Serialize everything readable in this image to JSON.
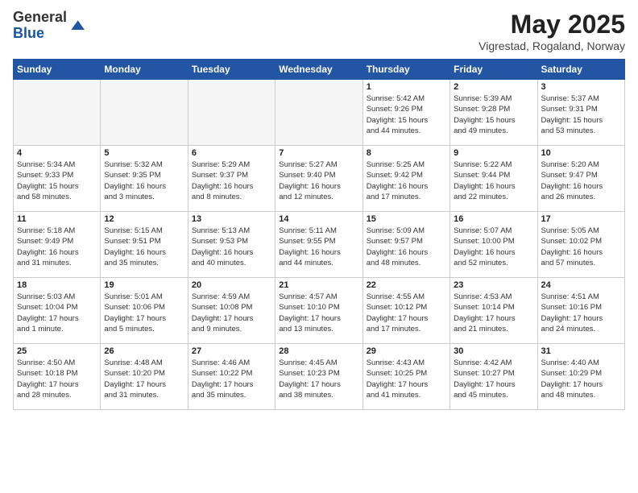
{
  "header": {
    "logo": {
      "general": "General",
      "blue": "Blue"
    },
    "title": "May 2025",
    "subtitle": "Vigrestad, Rogaland, Norway"
  },
  "weekdays": [
    "Sunday",
    "Monday",
    "Tuesday",
    "Wednesday",
    "Thursday",
    "Friday",
    "Saturday"
  ],
  "weeks": [
    [
      {
        "day": "",
        "detail": ""
      },
      {
        "day": "",
        "detail": ""
      },
      {
        "day": "",
        "detail": ""
      },
      {
        "day": "",
        "detail": ""
      },
      {
        "day": "1",
        "detail": "Sunrise: 5:42 AM\nSunset: 9:26 PM\nDaylight: 15 hours\nand 44 minutes."
      },
      {
        "day": "2",
        "detail": "Sunrise: 5:39 AM\nSunset: 9:28 PM\nDaylight: 15 hours\nand 49 minutes."
      },
      {
        "day": "3",
        "detail": "Sunrise: 5:37 AM\nSunset: 9:31 PM\nDaylight: 15 hours\nand 53 minutes."
      }
    ],
    [
      {
        "day": "4",
        "detail": "Sunrise: 5:34 AM\nSunset: 9:33 PM\nDaylight: 15 hours\nand 58 minutes."
      },
      {
        "day": "5",
        "detail": "Sunrise: 5:32 AM\nSunset: 9:35 PM\nDaylight: 16 hours\nand 3 minutes."
      },
      {
        "day": "6",
        "detail": "Sunrise: 5:29 AM\nSunset: 9:37 PM\nDaylight: 16 hours\nand 8 minutes."
      },
      {
        "day": "7",
        "detail": "Sunrise: 5:27 AM\nSunset: 9:40 PM\nDaylight: 16 hours\nand 12 minutes."
      },
      {
        "day": "8",
        "detail": "Sunrise: 5:25 AM\nSunset: 9:42 PM\nDaylight: 16 hours\nand 17 minutes."
      },
      {
        "day": "9",
        "detail": "Sunrise: 5:22 AM\nSunset: 9:44 PM\nDaylight: 16 hours\nand 22 minutes."
      },
      {
        "day": "10",
        "detail": "Sunrise: 5:20 AM\nSunset: 9:47 PM\nDaylight: 16 hours\nand 26 minutes."
      }
    ],
    [
      {
        "day": "11",
        "detail": "Sunrise: 5:18 AM\nSunset: 9:49 PM\nDaylight: 16 hours\nand 31 minutes."
      },
      {
        "day": "12",
        "detail": "Sunrise: 5:15 AM\nSunset: 9:51 PM\nDaylight: 16 hours\nand 35 minutes."
      },
      {
        "day": "13",
        "detail": "Sunrise: 5:13 AM\nSunset: 9:53 PM\nDaylight: 16 hours\nand 40 minutes."
      },
      {
        "day": "14",
        "detail": "Sunrise: 5:11 AM\nSunset: 9:55 PM\nDaylight: 16 hours\nand 44 minutes."
      },
      {
        "day": "15",
        "detail": "Sunrise: 5:09 AM\nSunset: 9:57 PM\nDaylight: 16 hours\nand 48 minutes."
      },
      {
        "day": "16",
        "detail": "Sunrise: 5:07 AM\nSunset: 10:00 PM\nDaylight: 16 hours\nand 52 minutes."
      },
      {
        "day": "17",
        "detail": "Sunrise: 5:05 AM\nSunset: 10:02 PM\nDaylight: 16 hours\nand 57 minutes."
      }
    ],
    [
      {
        "day": "18",
        "detail": "Sunrise: 5:03 AM\nSunset: 10:04 PM\nDaylight: 17 hours\nand 1 minute."
      },
      {
        "day": "19",
        "detail": "Sunrise: 5:01 AM\nSunset: 10:06 PM\nDaylight: 17 hours\nand 5 minutes."
      },
      {
        "day": "20",
        "detail": "Sunrise: 4:59 AM\nSunset: 10:08 PM\nDaylight: 17 hours\nand 9 minutes."
      },
      {
        "day": "21",
        "detail": "Sunrise: 4:57 AM\nSunset: 10:10 PM\nDaylight: 17 hours\nand 13 minutes."
      },
      {
        "day": "22",
        "detail": "Sunrise: 4:55 AM\nSunset: 10:12 PM\nDaylight: 17 hours\nand 17 minutes."
      },
      {
        "day": "23",
        "detail": "Sunrise: 4:53 AM\nSunset: 10:14 PM\nDaylight: 17 hours\nand 21 minutes."
      },
      {
        "day": "24",
        "detail": "Sunrise: 4:51 AM\nSunset: 10:16 PM\nDaylight: 17 hours\nand 24 minutes."
      }
    ],
    [
      {
        "day": "25",
        "detail": "Sunrise: 4:50 AM\nSunset: 10:18 PM\nDaylight: 17 hours\nand 28 minutes."
      },
      {
        "day": "26",
        "detail": "Sunrise: 4:48 AM\nSunset: 10:20 PM\nDaylight: 17 hours\nand 31 minutes."
      },
      {
        "day": "27",
        "detail": "Sunrise: 4:46 AM\nSunset: 10:22 PM\nDaylight: 17 hours\nand 35 minutes."
      },
      {
        "day": "28",
        "detail": "Sunrise: 4:45 AM\nSunset: 10:23 PM\nDaylight: 17 hours\nand 38 minutes."
      },
      {
        "day": "29",
        "detail": "Sunrise: 4:43 AM\nSunset: 10:25 PM\nDaylight: 17 hours\nand 41 minutes."
      },
      {
        "day": "30",
        "detail": "Sunrise: 4:42 AM\nSunset: 10:27 PM\nDaylight: 17 hours\nand 45 minutes."
      },
      {
        "day": "31",
        "detail": "Sunrise: 4:40 AM\nSunset: 10:29 PM\nDaylight: 17 hours\nand 48 minutes."
      }
    ]
  ]
}
